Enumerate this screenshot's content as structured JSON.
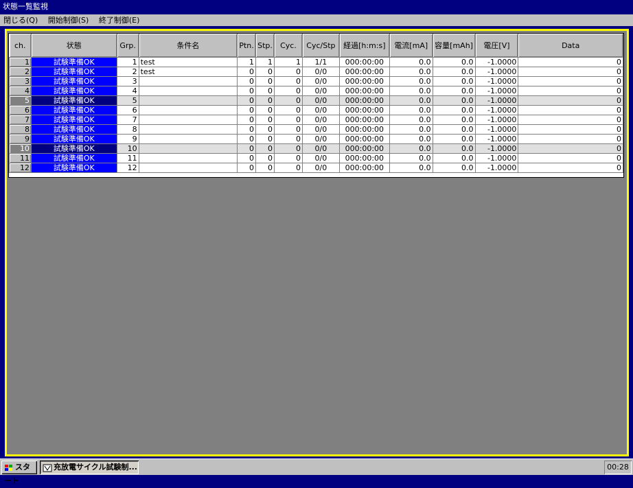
{
  "window": {
    "title": "状態一覧監視"
  },
  "menu": {
    "items": [
      "閉じる(Q)",
      "開始制御(S)",
      "終了制御(E)"
    ]
  },
  "table": {
    "headers": [
      "ch.",
      "状態",
      "Grp.",
      "条件名",
      "Ptn.",
      "Stp.",
      "Cyc.",
      "Cyc/Stp",
      "経過[h:m:s]",
      "電流[mA]",
      "容量[mAh]",
      "電圧[V]",
      "Data"
    ],
    "rows": [
      [
        "1",
        "試験準備OK",
        "1",
        "test",
        "1",
        "1",
        "1",
        "1/1",
        "000:00:00",
        "0.0",
        "0.0",
        "-1.0000",
        "0"
      ],
      [
        "2",
        "試験準備OK",
        "2",
        "test",
        "0",
        "0",
        "0",
        "0/0",
        "000:00:00",
        "0.0",
        "0.0",
        "-1.0000",
        "0"
      ],
      [
        "3",
        "試験準備OK",
        "3",
        "",
        "0",
        "0",
        "0",
        "0/0",
        "000:00:00",
        "0.0",
        "0.0",
        "-1.0000",
        "0"
      ],
      [
        "4",
        "試験準備OK",
        "4",
        "",
        "0",
        "0",
        "0",
        "0/0",
        "000:00:00",
        "0.0",
        "0.0",
        "-1.0000",
        "0"
      ],
      [
        "5",
        "試験準備OK",
        "5",
        "",
        "0",
        "0",
        "0",
        "0/0",
        "000:00:00",
        "0.0",
        "0.0",
        "-1.0000",
        "0"
      ],
      [
        "6",
        "試験準備OK",
        "6",
        "",
        "0",
        "0",
        "0",
        "0/0",
        "000:00:00",
        "0.0",
        "0.0",
        "-1.0000",
        "0"
      ],
      [
        "7",
        "試験準備OK",
        "7",
        "",
        "0",
        "0",
        "0",
        "0/0",
        "000:00:00",
        "0.0",
        "0.0",
        "-1.0000",
        "0"
      ],
      [
        "8",
        "試験準備OK",
        "8",
        "",
        "0",
        "0",
        "0",
        "0/0",
        "000:00:00",
        "0.0",
        "0.0",
        "-1.0000",
        "0"
      ],
      [
        "9",
        "試験準備OK",
        "9",
        "",
        "0",
        "0",
        "0",
        "0/0",
        "000:00:00",
        "0.0",
        "0.0",
        "-1.0000",
        "0"
      ],
      [
        "10",
        "試験準備OK",
        "10",
        "",
        "0",
        "0",
        "0",
        "0/0",
        "000:00:00",
        "0.0",
        "0.0",
        "-1.0000",
        "0"
      ],
      [
        "11",
        "試験準備OK",
        "11",
        "",
        "0",
        "0",
        "0",
        "0/0",
        "000:00:00",
        "0.0",
        "0.0",
        "-1.0000",
        "0"
      ],
      [
        "12",
        "試験準備OK",
        "12",
        "",
        "0",
        "0",
        "0",
        "0/0",
        "000:00:00",
        "0.0",
        "0.0",
        "-1.0000",
        "0"
      ]
    ],
    "highlighted_channels": [
      "5",
      "10"
    ]
  },
  "taskbar": {
    "start_label": "スタート",
    "task_label": "充放電サイクル試験制...",
    "clock": "00:28"
  },
  "colors": {
    "status_bg": "#0000ff",
    "title_bg": "#000080",
    "frame_accent": "#ffff00",
    "client_bg": "#808080"
  }
}
